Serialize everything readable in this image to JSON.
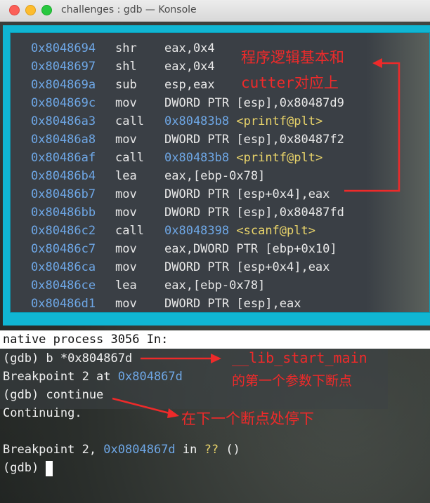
{
  "window": {
    "title": "challenges : gdb — Konsole"
  },
  "disassembly": [
    {
      "addr": "0x8048694",
      "mn": "shr",
      "op": "eax,0x4"
    },
    {
      "addr": "0x8048697",
      "mn": "shl",
      "op": "eax,0x4"
    },
    {
      "addr": "0x804869a",
      "mn": "sub",
      "op": "esp,eax"
    },
    {
      "addr": "0x804869c",
      "mn": "mov",
      "op": "DWORD PTR [esp],0x80487d9"
    },
    {
      "addr": "0x80486a3",
      "mn": "call",
      "target": "0x80483b8",
      "sym": "<printf@plt>"
    },
    {
      "addr": "0x80486a8",
      "mn": "mov",
      "op": "DWORD PTR [esp],0x80487f2"
    },
    {
      "addr": "0x80486af",
      "mn": "call",
      "target": "0x80483b8",
      "sym": "<printf@plt>"
    },
    {
      "addr": "0x80486b4",
      "mn": "lea",
      "op": "eax,[ebp-0x78]"
    },
    {
      "addr": "0x80486b7",
      "mn": "mov",
      "op": "DWORD PTR [esp+0x4],eax"
    },
    {
      "addr": "0x80486bb",
      "mn": "mov",
      "op": "DWORD PTR [esp],0x80487fd"
    },
    {
      "addr": "0x80486c2",
      "mn": "call",
      "target": "0x8048398",
      "sym": "<scanf@plt>"
    },
    {
      "addr": "0x80486c7",
      "mn": "mov",
      "op": "eax,DWORD PTR [ebp+0x10]"
    },
    {
      "addr": "0x80486ca",
      "mn": "mov",
      "op": "DWORD PTR [esp+0x4],eax"
    },
    {
      "addr": "0x80486ce",
      "mn": "lea",
      "op": "eax,[ebp-0x78]"
    },
    {
      "addr": "0x80486d1",
      "mn": "mov",
      "op": "DWORD PTR [esp],eax"
    }
  ],
  "console": {
    "status": "native process 3056 In:",
    "cmd1": "(gdb) b *0x804867d",
    "bp_prefix": "Breakpoint 2 at ",
    "bp_addr": "0x804867d",
    "cmd2": "(gdb) continue",
    "continuing": "Continuing.",
    "hit_prefix": "Breakpoint 2, ",
    "hit_addr": "0x0804867d",
    "hit_mid": " in ",
    "hit_func": "??",
    "hit_suffix": " ()",
    "prompt": "(gdb) "
  },
  "annotations": {
    "note1_line1": "程序逻辑基本和",
    "note1_line2": "cutter对应上",
    "note2_line1": "__lib_start_main",
    "note2_line2": "的第一个参数下断点",
    "note3": "在下一个断点处停下"
  },
  "colors": {
    "frame": "#10b6d3",
    "address": "#6ea7e6",
    "symbol": "#e8d36a",
    "annotation": "#ee2a2a"
  }
}
